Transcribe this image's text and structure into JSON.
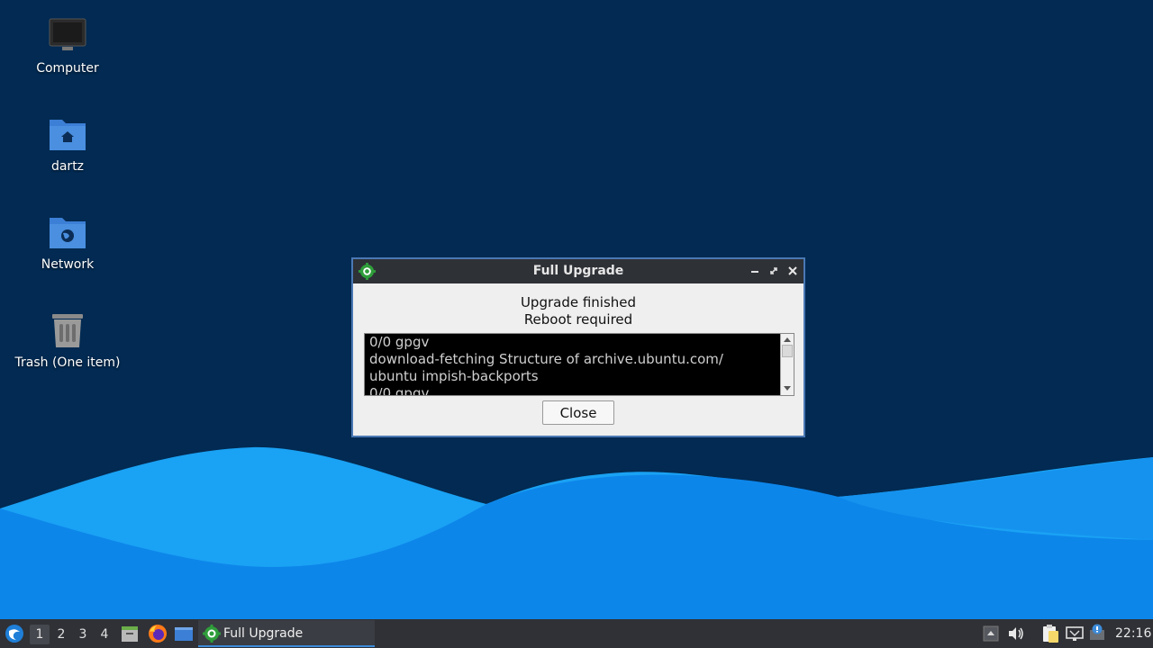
{
  "desktop": {
    "icons": [
      {
        "label": "Computer",
        "icon": "computer-icon"
      },
      {
        "label": "dartz",
        "icon": "home-folder-icon"
      },
      {
        "label": "Network",
        "icon": "network-folder-icon"
      },
      {
        "label": "Trash (One item)",
        "icon": "trash-icon"
      }
    ],
    "colors": {
      "background": "#022a52",
      "wave_light": "#1ca3f5",
      "wave_mid": "#0c84e8",
      "folder": "#4a8fe0"
    }
  },
  "dialog": {
    "title": "Full Upgrade",
    "status_line_1": "Upgrade finished",
    "status_line_2": "Reboot required",
    "log_lines": [
      "0/0 gpgv",
      "download-fetching Structure of archive.ubuntu.com/",
      "ubuntu impish-backports",
      "0/0 gpgv"
    ],
    "close_label": "Close",
    "titlebar_buttons": [
      "minimize-icon",
      "maximize-icon",
      "close-icon"
    ],
    "colors": {
      "titlebar": "#2e3136",
      "border": "#4a78b4",
      "log_bg": "#000000"
    }
  },
  "taskbar": {
    "workspaces": [
      "1",
      "2",
      "3",
      "4"
    ],
    "active_workspace": "1",
    "launchers": [
      "start-menu-icon",
      "file-manager-icon",
      "firefox-icon",
      "show-desktop-icon"
    ],
    "task_label": "Full Upgrade",
    "tray_icons": [
      "tray-arrow-icon",
      "volume-icon",
      "clipboard-icon",
      "network-icon",
      "update-notifier-icon"
    ],
    "clock": "22:16",
    "colors": {
      "background": "#2f3136",
      "active_underline": "#3d8bd8"
    }
  }
}
